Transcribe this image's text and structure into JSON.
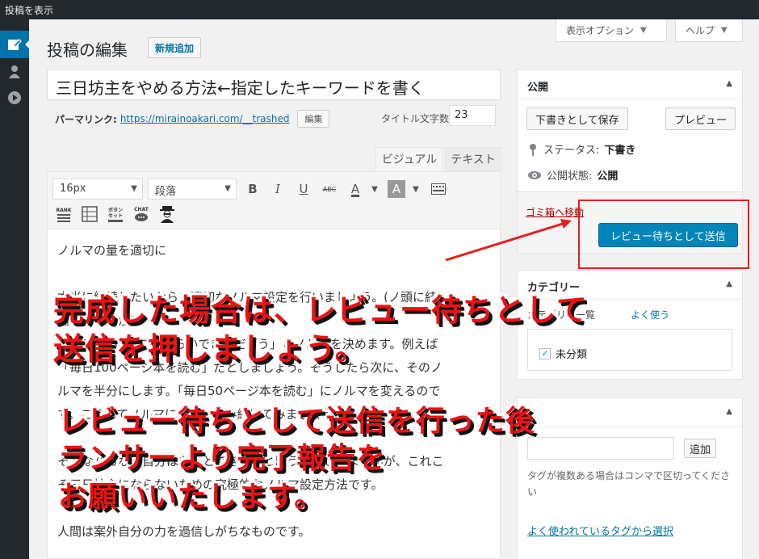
{
  "admin_bar": {
    "title": "投稿を表示"
  },
  "screen_options": {
    "options_label": "表示オプション",
    "help_label": "ヘルプ"
  },
  "header": {
    "title": "投稿の編集",
    "add_new": "新規追加"
  },
  "post": {
    "title": "三日坊主をやめる方法←指定したキーワードを書く",
    "permalink_label": "パーマリンク:",
    "permalink_url": "https://mirainoakari.com/__trashed",
    "edit_label": "編集",
    "title_count_label": "タイトル文字数:",
    "title_count": "23"
  },
  "editor": {
    "tab_visual": "ビジュアル",
    "tab_text": "テキスト",
    "font_size": "16px",
    "format": "段落",
    "icons": [
      "bold-icon",
      "italic-icon",
      "underline-icon",
      "strikethrough-icon",
      "text-color-icon",
      "background-color-icon",
      "toolbar-toggle-icon",
      "rank-icon",
      "table-icon",
      "button-set-icon",
      "chat-icon",
      "person-icon"
    ],
    "toolbar_text": {
      "bold": "B",
      "italic": "I",
      "underline": "U",
      "strike": "ABC",
      "color": "A",
      "bg": "A",
      "rank": "RANK",
      "button_set": "ボタン\nセット",
      "chat": "CHAT"
    },
    "paragraphs": [
      "ノルマの量を適切に",
      "",
      "本当に継続したいなら、適切なノルマ設定を行いましょう。(ノ頭に結",
      "論ありますが)",
      "まず1週間に「これくらいできるだろう」とノルマを決めます。例えば",
      "「毎日100ページ本を読む」だとしましょう。そうしたら次に、そのノ",
      "ルマを半分にします。「毎日50ページ本を読む」にノルマを変えるので",
      "す。こうしてノルマにしてい読み続けてみましょう。",
      "",
      "そんなバカな、自分はもっとできる！と思うかもしれませんが、これこ",
      "そ三日坊主にならないための究極的なノルマ設定方法です。",
      "",
      "人間は案外自分の力を過信しがちなものです。"
    ]
  },
  "publish": {
    "title": "公開",
    "save_draft": "下書きとして保存",
    "preview": "プレビュー",
    "status_label": "ステータス:",
    "status_value": "下書き",
    "visibility_label": "公開状態:",
    "visibility_value": "公開",
    "trash": "ゴミ箱へ移動",
    "submit": "レビュー待ちとして送信"
  },
  "category": {
    "title": "カテゴリー",
    "tab_all": "カテゴリー一覧",
    "tab_popular": "よく使う",
    "item": "未分類",
    "checked": true
  },
  "tags": {
    "add": "追加",
    "hint": "タグが複数ある場合はコンマで区切ってください",
    "popular_link": "よく使われているタグから選択"
  },
  "overlay": {
    "line1": "完成した場合は、レビュー待ちとして",
    "line2": "送信を押しましょう。",
    "line3": "レビュー待ちとして送信を行った後",
    "line4": "ランサーより完了報告を",
    "line5": "お願いいたします。",
    "color": "#ee1111"
  },
  "colors": {
    "primary": "#0085ba",
    "admin_bar": "#23282d",
    "highlight": "#e81c1c"
  }
}
